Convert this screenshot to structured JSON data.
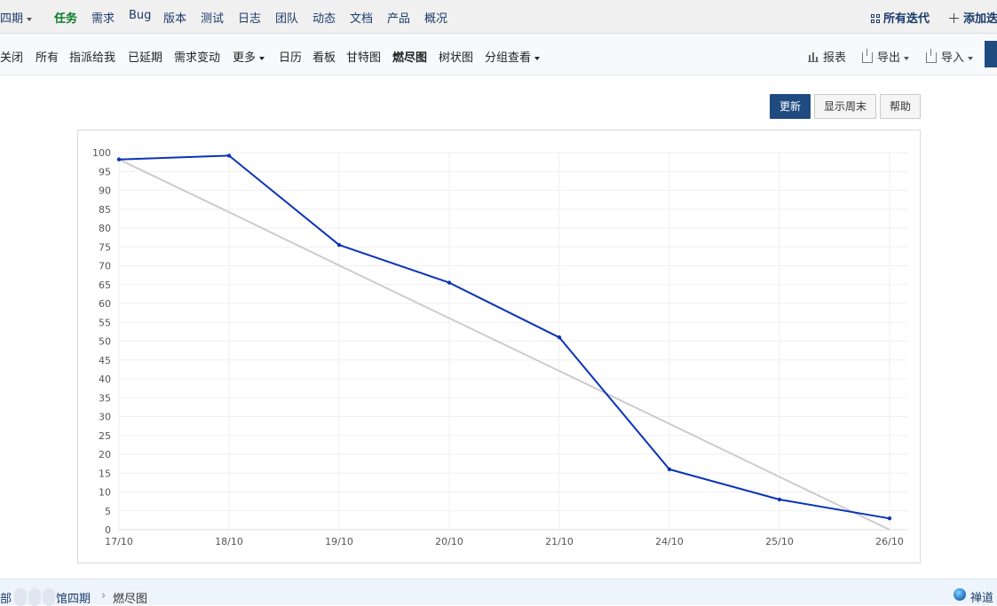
{
  "topnav": {
    "project": "四期",
    "items": [
      "任务",
      "需求",
      "Bug",
      "版本",
      "测试",
      "日志",
      "团队",
      "动态",
      "文档",
      "产品",
      "概况"
    ],
    "all_iterations": "所有迭代",
    "add": "添加迭"
  },
  "subnav": {
    "items": [
      "关闭",
      "所有",
      "指派给我",
      "已延期",
      "需求变动",
      "更多",
      "日历",
      "看板",
      "甘特图",
      "燃尽图",
      "树状图",
      "分组查看"
    ],
    "report": "报表",
    "export": "导出",
    "import": "导入"
  },
  "buttons": {
    "update": "更新",
    "show_weekend": "显示周末",
    "help": "帮助"
  },
  "chart_data": {
    "type": "line",
    "categories": [
      "17/10",
      "18/10",
      "19/10",
      "20/10",
      "21/10",
      "24/10",
      "25/10",
      "26/10"
    ],
    "ylim": [
      0,
      100
    ],
    "yticks": [
      0,
      5,
      10,
      15,
      20,
      25,
      30,
      35,
      40,
      45,
      50,
      55,
      60,
      65,
      70,
      75,
      80,
      85,
      90,
      95,
      100
    ],
    "series": [
      {
        "values": [
          98.2,
          99.2,
          75.5,
          65.5,
          51,
          16,
          8,
          3
        ],
        "color": "#0a33b8",
        "markers": true
      },
      {
        "values": [
          98.2,
          84.2,
          70.1,
          56.1,
          42.1,
          28.1,
          14,
          0
        ],
        "color": "#cccccc",
        "markers": false
      }
    ],
    "grid": true
  },
  "footer": {
    "crumb_part1": "部",
    "crumb_part2": "馆四期",
    "separator": "›",
    "current": "燃尽图",
    "brand": "禅道"
  }
}
